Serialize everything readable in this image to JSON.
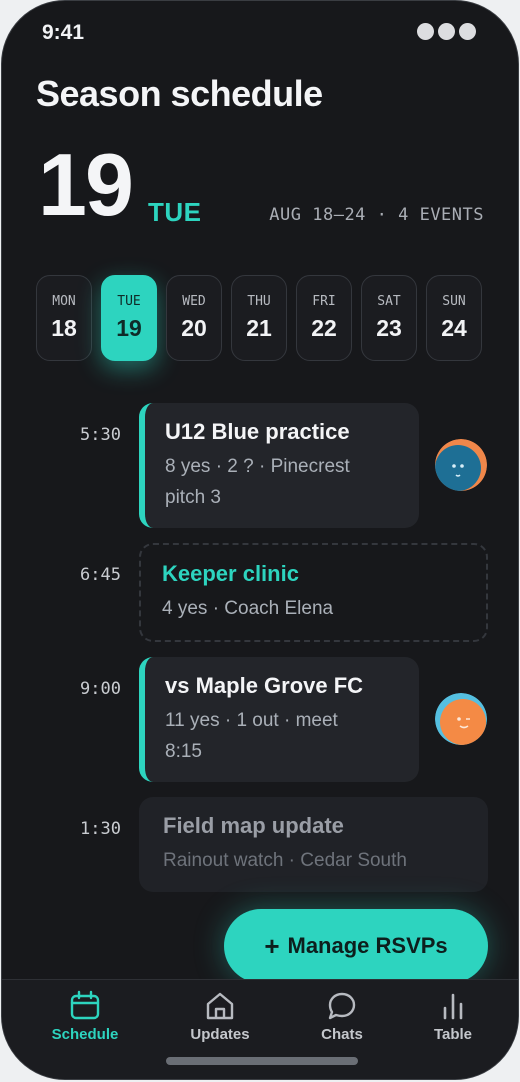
{
  "status": {
    "time": "9:41"
  },
  "header": {
    "title": "Season schedule",
    "day_number": "19",
    "day_of_week": "TUE",
    "week_info": "AUG 18–24 · 4 EVENTS"
  },
  "days": [
    {
      "dow": "MON",
      "num": "18",
      "selected": false
    },
    {
      "dow": "TUE",
      "num": "19",
      "selected": true
    },
    {
      "dow": "WED",
      "num": "20",
      "selected": false
    },
    {
      "dow": "THU",
      "num": "21",
      "selected": false
    },
    {
      "dow": "FRI",
      "num": "22",
      "selected": false
    },
    {
      "dow": "SAT",
      "num": "23",
      "selected": false
    },
    {
      "dow": "SUN",
      "num": "24",
      "selected": false
    }
  ],
  "events": [
    {
      "time": "5:30",
      "title": "U12 Blue practice",
      "line1": "8 yes · 2 ? · Pinecrest",
      "line2": "pitch 3",
      "avatar_icon": "teal-face-avatar-icon"
    },
    {
      "time": "6:45",
      "title": "Keeper clinic",
      "line1": "4 yes · Coach Elena"
    },
    {
      "time": "9:00",
      "title": "vs Maple Grove FC",
      "line1": "11 yes · 1 out · meet",
      "line2": "8:15",
      "avatar_icon": "orange-face-avatar-icon"
    },
    {
      "time": "1:30",
      "title": "Field map update",
      "line1": "Rainout watch · Cedar South"
    }
  ],
  "fab": {
    "label": "Manage RSVPs",
    "icon": "plus-icon"
  },
  "tabs": [
    {
      "label": "Schedule",
      "icon": "calendar-icon",
      "active": true
    },
    {
      "label": "Updates",
      "icon": "home-icon",
      "active": false
    },
    {
      "label": "Chats",
      "icon": "chat-bubble-icon",
      "active": false
    },
    {
      "label": "Table",
      "icon": "bar-chart-icon",
      "active": false
    }
  ],
  "colors": {
    "accent": "#2dd4bf",
    "background": "#17181b",
    "card": "#23252a"
  }
}
